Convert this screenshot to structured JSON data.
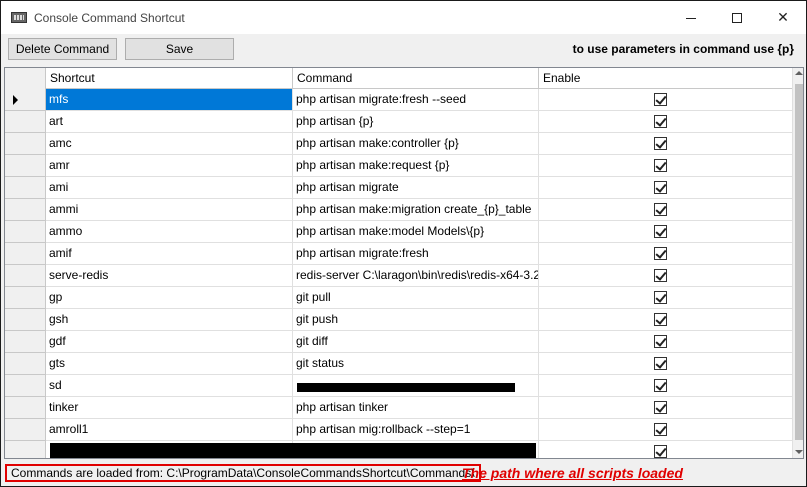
{
  "window": {
    "title": "Console Command Shortcut",
    "icon": "keyboard-icon"
  },
  "toolbar": {
    "delete_label": "Delete Command",
    "save_label": "Save",
    "hint": "to use parameters in command use {p}"
  },
  "grid": {
    "columns": [
      "Shortcut",
      "Command",
      "Enable"
    ],
    "selected_row": 0,
    "rows": [
      {
        "shortcut": "mfs",
        "command": "php artisan migrate:fresh --seed",
        "enable": true
      },
      {
        "shortcut": "art",
        "command": "php artisan {p}",
        "enable": true
      },
      {
        "shortcut": "amc",
        "command": "php artisan make:controller {p}",
        "enable": true
      },
      {
        "shortcut": "amr",
        "command": "php artisan make:request {p}",
        "enable": true
      },
      {
        "shortcut": "ami",
        "command": "php artisan migrate",
        "enable": true
      },
      {
        "shortcut": "ammi",
        "command": "php artisan make:migration create_{p}_table",
        "enable": true
      },
      {
        "shortcut": "ammo",
        "command": "php artisan make:model Models\\{p}",
        "enable": true
      },
      {
        "shortcut": "amif",
        "command": "php artisan migrate:fresh",
        "enable": true
      },
      {
        "shortcut": "serve-redis",
        "command": "redis-server C:\\laragon\\bin\\redis\\redis-x64-3.2...",
        "enable": true
      },
      {
        "shortcut": "gp",
        "command": "git pull",
        "enable": true
      },
      {
        "shortcut": "gsh",
        "command": "git push",
        "enable": true
      },
      {
        "shortcut": "gdf",
        "command": "git diff",
        "enable": true
      },
      {
        "shortcut": "gts",
        "command": "git status",
        "enable": true
      },
      {
        "shortcut": "sd",
        "command": "",
        "enable": true
      },
      {
        "shortcut": "tinker",
        "command": "php artisan tinker",
        "enable": true
      },
      {
        "shortcut": "amroll1",
        "command": "php artisan mig:rollback --step=1",
        "enable": true
      },
      {
        "shortcut": "",
        "command": "",
        "enable": true
      }
    ]
  },
  "status": {
    "text": "Commands are loaded from: C:\\ProgramData\\ConsoleCommandsShortcut\\Commands\\",
    "annotation": "The path where all scripts loaded"
  },
  "colors": {
    "selection": "#0078d7",
    "annotation": "#e00000"
  }
}
